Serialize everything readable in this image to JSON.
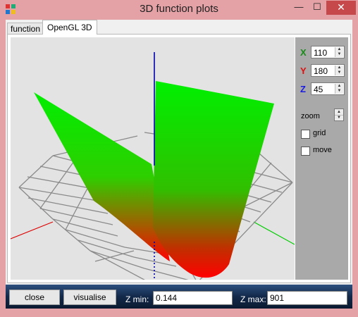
{
  "window": {
    "title": "3D function plots",
    "controls": {
      "minimize": "—",
      "maximize": "☐",
      "close": "✕"
    }
  },
  "tabs": [
    {
      "label": "function",
      "selected": false
    },
    {
      "label": "OpenGL 3D",
      "selected": true
    }
  ],
  "rotation": {
    "x": {
      "label": "X",
      "value": "110",
      "color": "#1a8a1a"
    },
    "y": {
      "label": "Y",
      "value": "180",
      "color": "#dd1111"
    },
    "z": {
      "label": "Z",
      "value": "45",
      "color": "#1a1ae0"
    }
  },
  "zoom": {
    "label": "zoom"
  },
  "options": {
    "grid": {
      "label": "grid",
      "checked": false
    },
    "move": {
      "label": "move",
      "checked": false
    }
  },
  "footer": {
    "close_label": "close",
    "visualise_label": "visualise",
    "zmin_label": "Z min:",
    "zmin_value": "0.144",
    "zmax_label": "Z max:",
    "zmax_value": "901"
  },
  "plot": {
    "surface_top_color": "#00ee00",
    "surface_bottom_color": "#ff0000",
    "grid_color": "#8a8a8a",
    "axis_x_color": "#00cc00",
    "axis_y_color": "#dd0000",
    "axis_z_color": "#0000aa"
  }
}
